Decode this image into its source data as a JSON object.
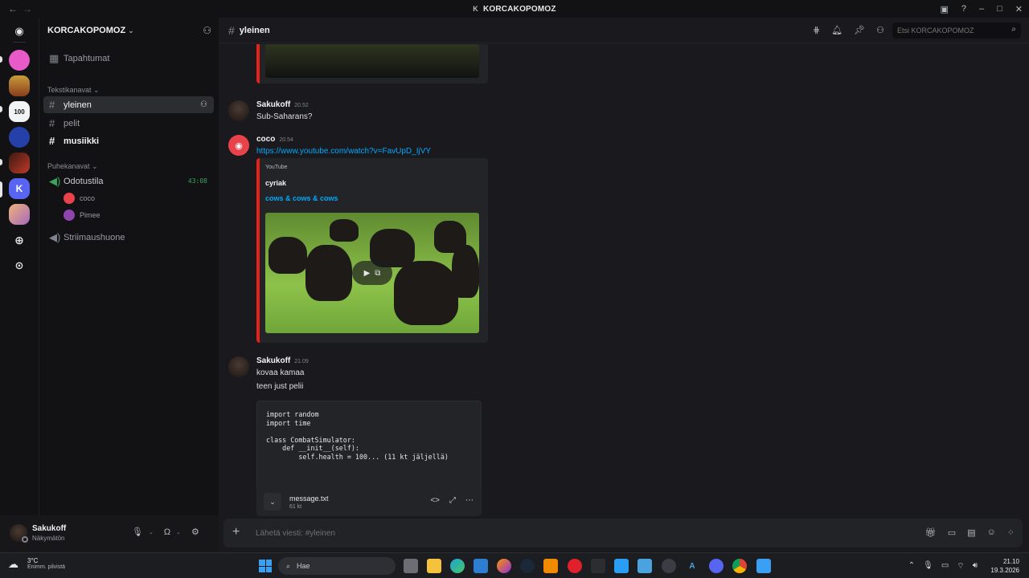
{
  "window": {
    "title": "KORCAKOPOMOZ",
    "title_glyph": "K"
  },
  "server": {
    "name": "KORCAKOPOMOZ"
  },
  "sidebar": {
    "events_label": "Tapahtumat",
    "text_category": "Tekstikanavat",
    "text_channels": [
      "yleinen",
      "pelit",
      "musiikki"
    ],
    "voice_category": "Puhekanavat",
    "voice_channels": [
      {
        "name": "Odotustila",
        "timer": "43:08",
        "users": [
          "coco",
          "Pimee"
        ]
      },
      {
        "name": "Striimaushuone"
      }
    ]
  },
  "user_panel": {
    "name": "Sakukoff",
    "status": "Näkymätön"
  },
  "channel": {
    "name": "yleinen",
    "search_placeholder": "Etsi KORCAKOPOMOZ"
  },
  "messages": [
    {
      "author": "Sakukoff",
      "time": "20.52",
      "lines": [
        "Sub-Saharans?"
      ]
    },
    {
      "author": "coco",
      "time": "20.54",
      "link": "https://www.youtube.com/watch?v=FavUpD_IjVY",
      "embed": {
        "provider": "YouTube",
        "channel": "cyriak",
        "title": "cows & cows & cows"
      }
    },
    {
      "author": "Sakukoff",
      "time": "21.09",
      "lines": [
        "kovaa kamaa",
        "teen just pelii"
      ],
      "code": "import random\nimport time\n\nclass CombatSimulator:\n    def __init__(self):\n        self.health = 100... (11 kt jäljellä)",
      "file": {
        "name": "message.txt",
        "size": "61 kt"
      }
    }
  ],
  "composer": {
    "placeholder": "Lähetä viesti: #yleinen"
  },
  "taskbar": {
    "weather_temp": "3°C",
    "weather_desc": "Enimm. pilvistä",
    "search_label": "Hae",
    "time": "21.10",
    "date": "19.3.2026"
  },
  "colors": {
    "accent": "#5865f2",
    "youtube_red": "#e62117",
    "link": "#00a8fc",
    "voice_green": "#3ba55d"
  }
}
